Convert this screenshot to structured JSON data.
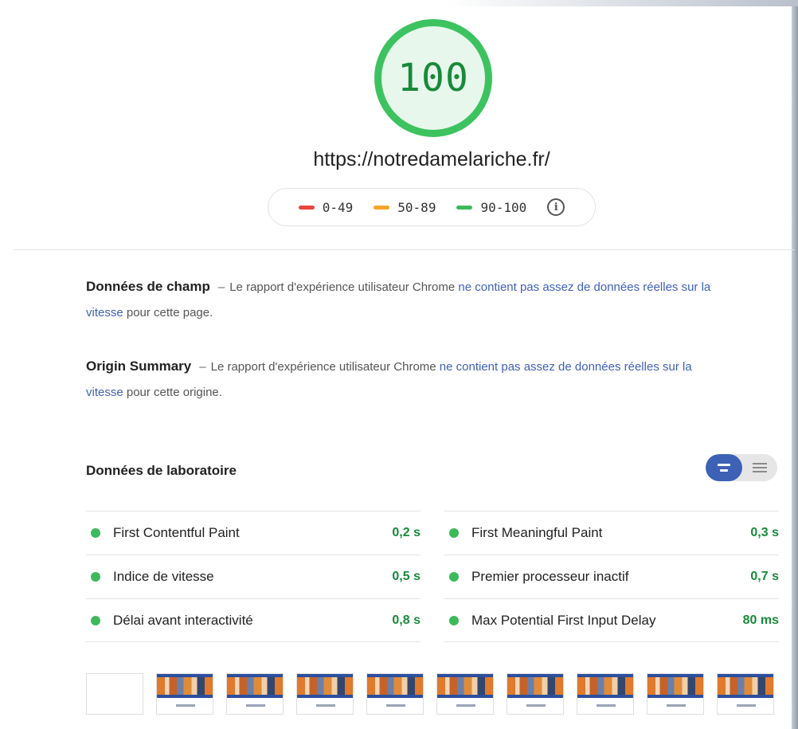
{
  "report": {
    "score": "100",
    "url": "https://notredamelariche.fr/",
    "legend": [
      {
        "range": "0-49",
        "color": "#e8453c"
      },
      {
        "range": "50-89",
        "color": "#f4a62a"
      },
      {
        "range": "90-100",
        "color": "#3cb95a"
      }
    ],
    "info_icon_glyph": "i"
  },
  "field_data": {
    "title": "Données de champ",
    "dash": "–",
    "text_before": "Le rapport d'expérience utilisateur Chrome",
    "link": "ne contient pas assez de données réelles sur la vitesse",
    "text_after": "pour cette page."
  },
  "origin_summary": {
    "title": "Origin Summary",
    "dash": "–",
    "text_before": "Le rapport d'expérience utilisateur Chrome",
    "link": "ne contient pas assez de données réelles sur la vitesse",
    "text_after": "pour cette origine."
  },
  "lab_data": {
    "title": "Données de laboratoire",
    "toggle_icons": [
      "view-compact-icon",
      "view-expanded-icon"
    ],
    "metrics_left": [
      {
        "label": "First Contentful Paint",
        "value": "0,2 s"
      },
      {
        "label": "Indice de vitesse",
        "value": "0,5 s"
      },
      {
        "label": "Délai avant interactivité",
        "value": "0,8 s"
      }
    ],
    "metrics_right": [
      {
        "label": "First Meaningful Paint",
        "value": "0,3 s"
      },
      {
        "label": "Premier processeur inactif",
        "value": "0,7 s"
      },
      {
        "label": "Max Potential First Input Delay",
        "value": "80 ms"
      }
    ],
    "status_color": "#3cb95a"
  },
  "filmstrip": {
    "frames": [
      "blank",
      "page",
      "page",
      "page",
      "page",
      "page",
      "page",
      "page",
      "page",
      "page"
    ]
  }
}
